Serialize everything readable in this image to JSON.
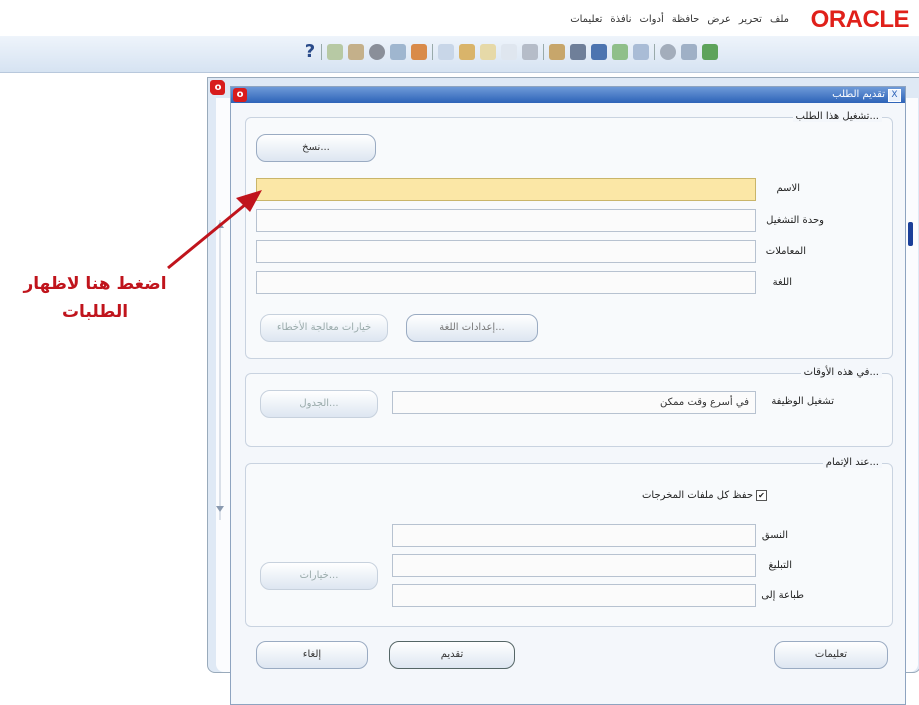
{
  "header": {
    "logo": "ORACLE",
    "menu": [
      "ملف",
      "تحرير",
      "عرض",
      "حافظة",
      "أدوات",
      "نافذة",
      "تعليمات"
    ]
  },
  "toolbar": {
    "help_label": "?"
  },
  "window": {
    "title": "تقديم الطلب",
    "close_label": "X"
  },
  "run_group": {
    "title": "تشغيل هذا الطلب...",
    "copy_button": "نسخ...",
    "labels": {
      "name": "الاسم",
      "unit": "وحدة التشغيل",
      "params": "المعاملات",
      "language": "اللغة"
    },
    "values": {
      "name": "",
      "unit": "",
      "params": "",
      "language": ""
    },
    "debug_button": "خيارات معالجة الأخطاء",
    "language_settings_button": "إعدادات اللغة..."
  },
  "times_group": {
    "title": "في هذه الأوقات...",
    "schedule_label": "تشغيل الوظيفة",
    "schedule_value": "في أسرع وقت ممكن",
    "schedule_button": "الجدول..."
  },
  "completion_group": {
    "title": "عند الإتمام...",
    "save_all_label": "حفظ كل ملفات المخرجات",
    "save_all_checked": true,
    "labels": {
      "layout": "النسق",
      "notify": "التبليغ",
      "print_to": "طباعة إلى"
    },
    "values": {
      "layout": "",
      "notify": "",
      "print_to": ""
    },
    "options_button": "خيارات..."
  },
  "footer": {
    "help_button": "تعليمات",
    "submit_button": "تقديم",
    "cancel_button": "إلغاء"
  },
  "annotation": {
    "line1": "اضغط هنا لاظهار",
    "line2": "الطلبات"
  },
  "colors": {
    "highlight_field": "#fbe7a6",
    "titlebar": "#2d63b8",
    "annotation": "#c0141c",
    "logo": "#e0201a"
  }
}
